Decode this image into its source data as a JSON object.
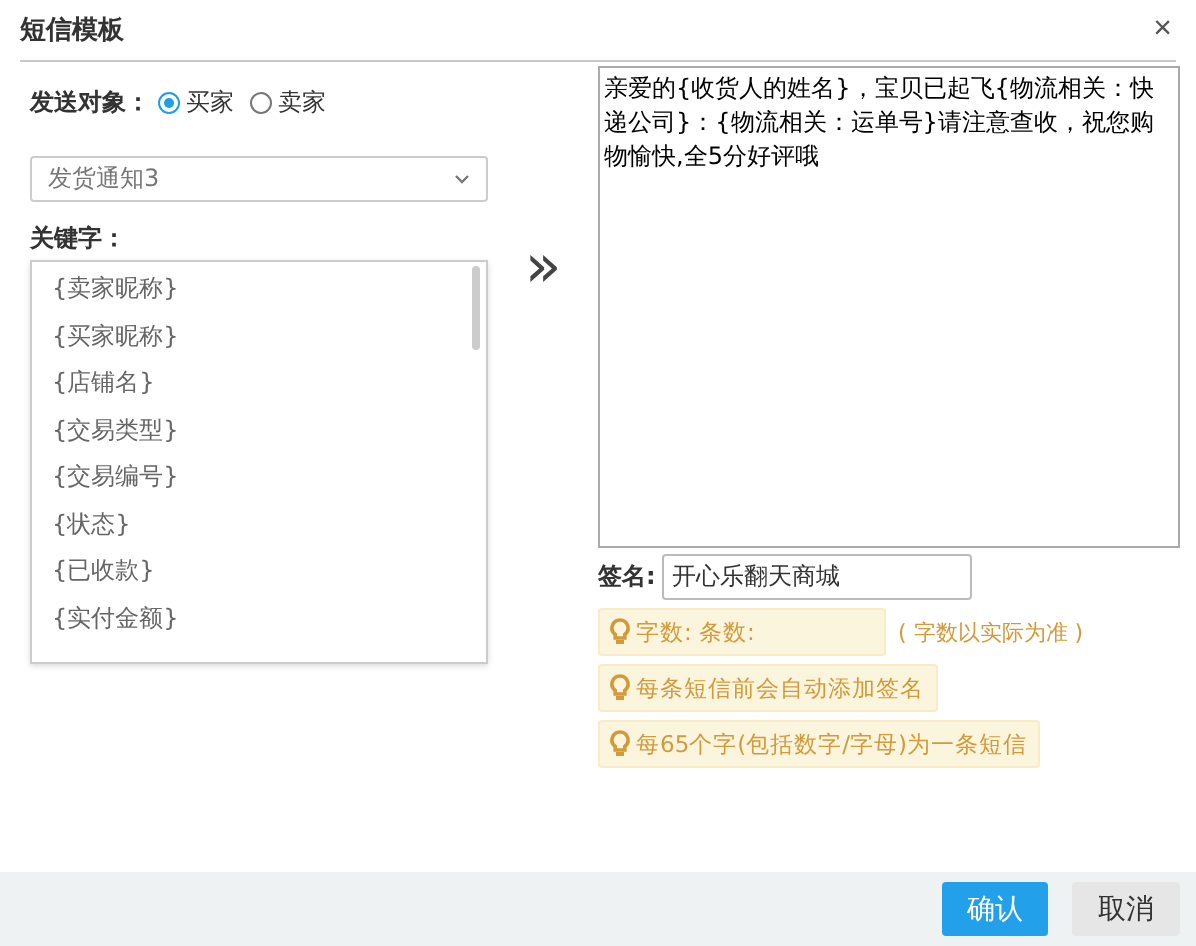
{
  "dialog": {
    "title": "短信模板",
    "close": "×"
  },
  "recipient": {
    "label": "发送对象：",
    "options": [
      {
        "label": "买家",
        "selected": true
      },
      {
        "label": "卖家",
        "selected": false
      }
    ]
  },
  "template_select": {
    "value": "发货通知3"
  },
  "keywords": {
    "label": "关键字：",
    "items": [
      "{卖家昵称}",
      "{买家昵称}",
      "{店铺名}",
      "{交易类型}",
      "{交易编号}",
      "{状态}",
      "{已收款}",
      "{实付金额}"
    ]
  },
  "insert_arrow": "»",
  "message": {
    "value": "亲爱的{收货人的姓名}，宝贝已起飞{物流相关：快递公司}：{物流相关：运单号}请注意查收，祝您购物愉快,全5分好评哦"
  },
  "signature": {
    "label": "签名:",
    "value": "开心乐翻天商城"
  },
  "tips": [
    {
      "text": "字数: 条数:",
      "note": "( 字数以实际为准 )"
    },
    {
      "text": "每条短信前会自动添加签名"
    },
    {
      "text": "每65个字(包括数字/字母)为一条短信"
    }
  ],
  "buttons": [
    {
      "label": "确认",
      "kind": "primary"
    },
    {
      "label": "取消",
      "kind": "secondary"
    }
  ]
}
